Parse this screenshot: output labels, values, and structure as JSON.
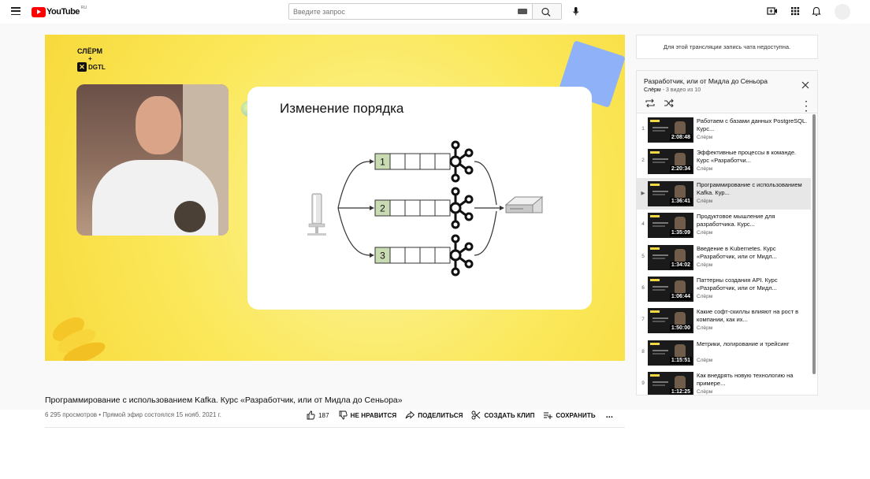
{
  "header": {
    "logo_text": "YouTube",
    "logo_country": "RU",
    "search_placeholder": "Введите запрос",
    "icons": [
      "menu-icon",
      "keyboard-icon",
      "search-icon",
      "mic-icon",
      "create-video-icon",
      "apps-icon",
      "bell-icon",
      "avatar"
    ]
  },
  "player": {
    "brand_top": "СЛЁРМ",
    "brand_plus": "+",
    "brand_bottom": "DGTL",
    "slide_title": "Изменение порядка",
    "partitions": [
      "1",
      "2",
      "3"
    ]
  },
  "video": {
    "title": "Программирование с использованием Kafka. Курс «Разработчик, или от Мидла до Сеньора»",
    "meta": "6 295 просмотров • Прямой эфир состоялся 15 нояб. 2021 г.",
    "likes": "187",
    "dislike_label": "НЕ НРАВИТСЯ",
    "share_label": "ПОДЕЛИТЬСЯ",
    "clip_label": "СОЗДАТЬ КЛИП",
    "save_label": "СОХРАНИТЬ",
    "more_label": "..."
  },
  "chat": {
    "message": "Для этой трансляции запись чата недоступна."
  },
  "playlist": {
    "title": "Разработчик, или от Мидла до Сеньора",
    "channel": "Слёрм",
    "position": " - 3 видео из 10",
    "items": [
      {
        "index": "1",
        "title": "Работаем с базами данных PostgreSQL. Курс...",
        "duration": "2:08:48",
        "channel": "Слёрм",
        "active": false
      },
      {
        "index": "2",
        "title": "Эффективные процессы в команде. Курс «Разработчи...",
        "duration": "2:20:34",
        "channel": "Слёрм",
        "active": false
      },
      {
        "index": "▶",
        "title": "Программирование с использованием Kafka. Кур...",
        "duration": "1:36:41",
        "channel": "Слёрм",
        "active": true
      },
      {
        "index": "4",
        "title": "Продуктовое мышление для разработчика. Курс...",
        "duration": "1:35:09",
        "channel": "Слёрм",
        "active": false
      },
      {
        "index": "5",
        "title": "Введение в Kubernetes. Курс «Разработчик, или от Мидл...",
        "duration": "1:34:02",
        "channel": "Слёрм",
        "active": false
      },
      {
        "index": "6",
        "title": "Паттерны создания API. Курс «Разработчик, или от Мидл...",
        "duration": "1:06:44",
        "channel": "Слёрм",
        "active": false
      },
      {
        "index": "7",
        "title": "Какие софт-скиллы влияют на рост в компании, как их...",
        "duration": "1:50:00",
        "channel": "Слёрм",
        "active": false
      },
      {
        "index": "8",
        "title": "Метрики, логирование и трейсинг",
        "duration": "1:15:51",
        "channel": "Слёрм",
        "active": false
      },
      {
        "index": "9",
        "title": "Как внедрять новую технологию на примере...",
        "duration": "1:12:25",
        "channel": "Слёрм",
        "active": false
      }
    ]
  }
}
